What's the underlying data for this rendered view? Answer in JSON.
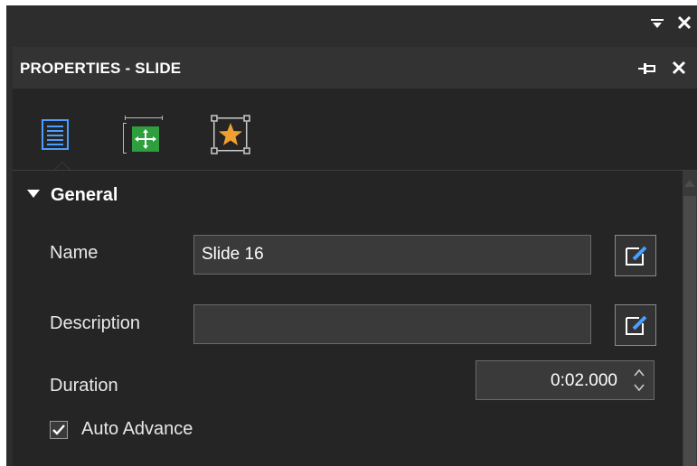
{
  "window": {
    "pin_dropdown_icon": "dropdown-arrow-icon",
    "close_icon": "close-icon"
  },
  "panel": {
    "title": "PROPERTIES - SLIDE",
    "pin_icon": "pin-icon",
    "close_icon": "close-icon"
  },
  "tabs": [
    {
      "name": "general-properties",
      "icon": "list-icon",
      "selected": true
    },
    {
      "name": "size-position",
      "icon": "move-icon",
      "selected": false
    },
    {
      "name": "effects",
      "icon": "star-icon",
      "selected": false
    }
  ],
  "section": {
    "title": "General",
    "expanded": true
  },
  "fields": {
    "name_label": "Name",
    "name_value": "Slide 16",
    "description_label": "Description",
    "description_value": "",
    "duration_label": "Duration",
    "duration_value": "0:02.000",
    "auto_advance_label": "Auto Advance",
    "auto_advance_checked": true
  },
  "colors": {
    "panel_bg": "#252525",
    "header_bg": "#333333",
    "accent_blue": "#4a9eff",
    "accent_green": "#2e9e3e",
    "accent_orange": "#f0a030"
  }
}
